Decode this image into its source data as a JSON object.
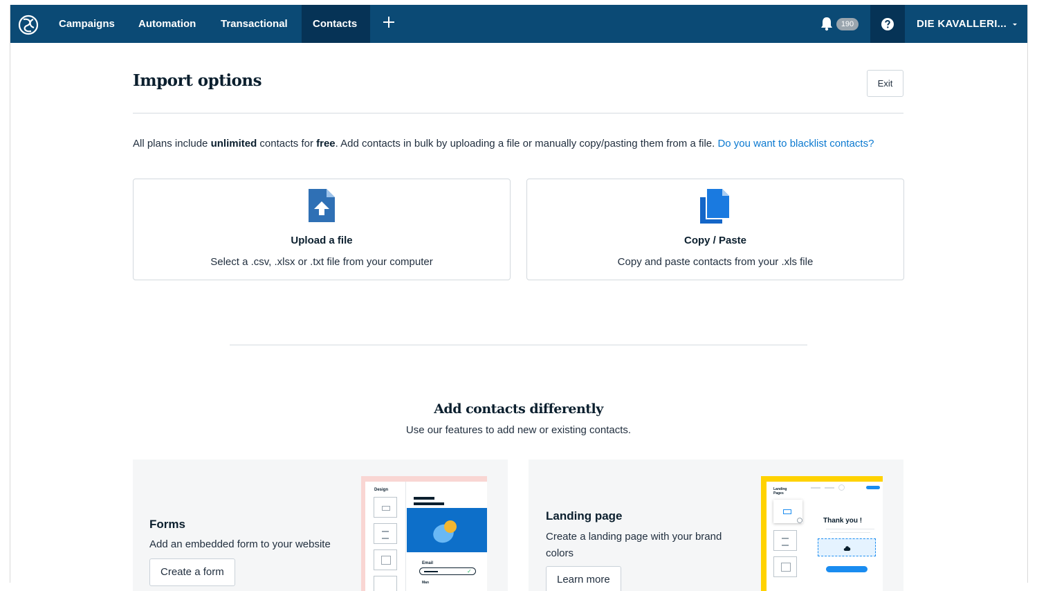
{
  "nav": {
    "items": [
      {
        "label": "Campaigns"
      },
      {
        "label": "Automation"
      },
      {
        "label": "Transactional"
      },
      {
        "label": "Contacts"
      }
    ],
    "notifications_count": "190",
    "account_name": "DIE KAVALLERI..."
  },
  "page": {
    "title": "Import options",
    "exit_label": "Exit",
    "intro": {
      "part1": "All plans include ",
      "bold1": "unlimited",
      "part2": " contacts for ",
      "bold2": "free",
      "part3": ". Add contacts in bulk by uploading a file or manually copy/pasting them from a file. ",
      "link": "Do you want to blacklist contacts?"
    }
  },
  "import_options": [
    {
      "title": "Upload a file",
      "description": "Select a .csv, .xlsx or .txt file from your computer",
      "icon": "upload-file-icon"
    },
    {
      "title": "Copy / Paste",
      "description": "Copy and paste contacts from your .xls file",
      "icon": "copy-documents-icon"
    }
  ],
  "alternatives": {
    "title": "Add contacts differently",
    "subtitle": "Use our features to add new or existing contacts.",
    "cards": [
      {
        "title": "Forms",
        "description": "Add an embedded form to your website",
        "button": "Create a form",
        "preview": {
          "panel_label": "Design",
          "field_label": "Email",
          "radio_label": "Man"
        }
      },
      {
        "title": "Landing page",
        "description": "Create a landing page with your brand colors",
        "button": "Learn more",
        "preview": {
          "panel_label": "Landing Pages",
          "heading": "Thank you !"
        }
      }
    ]
  },
  "colors": {
    "topbar": "#0b4a75",
    "active_nav": "#063356",
    "link": "#0b79d0",
    "icon_blue": "#1466c8",
    "forms_accent": "#f9d6d3",
    "landing_accent": "#ffd200"
  }
}
